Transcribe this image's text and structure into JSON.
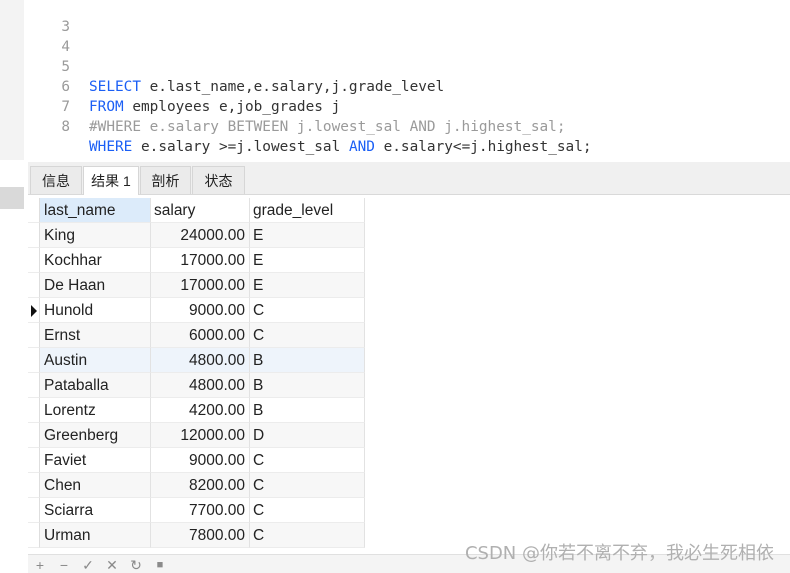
{
  "editor": {
    "lines": [
      {
        "num": "3"
      },
      {
        "num": "4"
      },
      {
        "num": "5",
        "kw1": "SELECT",
        "rest": " e.last_name,e.salary,j.grade_level"
      },
      {
        "num": "6",
        "kw1": "FROM",
        "rest": " employees e,job_grades j"
      },
      {
        "num": "7",
        "comment": "#WHERE e.salary BETWEEN j.lowest_sal AND j.highest_sal;"
      },
      {
        "num": "8",
        "kw1": "WHERE",
        "mid": " e.salary >=j.lowest_sal ",
        "kw2": "AND",
        "rest2": " e.salary<=j.highest_sal;"
      }
    ],
    "colors": {
      "keyword": "#1b5ff5",
      "comment": "#9a9a9a",
      "text": "#333333"
    }
  },
  "tabs": [
    {
      "label": "信息"
    },
    {
      "label": "结果 1",
      "active": true
    },
    {
      "label": "剖析"
    },
    {
      "label": "状态"
    }
  ],
  "grid": {
    "columns": [
      "last_name",
      "salary",
      "grade_level"
    ],
    "rows": [
      {
        "last_name": "King",
        "salary": "24000.00",
        "grade_level": "E"
      },
      {
        "last_name": "Kochhar",
        "salary": "17000.00",
        "grade_level": "E"
      },
      {
        "last_name": "De Haan",
        "salary": "17000.00",
        "grade_level": "E"
      },
      {
        "last_name": "Hunold",
        "salary": "9000.00",
        "grade_level": "C"
      },
      {
        "last_name": "Ernst",
        "salary": "6000.00",
        "grade_level": "C"
      },
      {
        "last_name": "Austin",
        "salary": "4800.00",
        "grade_level": "B"
      },
      {
        "last_name": "Pataballa",
        "salary": "4800.00",
        "grade_level": "B"
      },
      {
        "last_name": "Lorentz",
        "salary": "4200.00",
        "grade_level": "B"
      },
      {
        "last_name": "Greenberg",
        "salary": "12000.00",
        "grade_level": "D"
      },
      {
        "last_name": "Faviet",
        "salary": "9000.00",
        "grade_level": "C"
      },
      {
        "last_name": "Chen",
        "salary": "8200.00",
        "grade_level": "C"
      },
      {
        "last_name": "Sciarra",
        "salary": "7700.00",
        "grade_level": "C"
      },
      {
        "last_name": "Urman",
        "salary": "7800.00",
        "grade_level": "C"
      }
    ],
    "current_row_index": 3
  },
  "toolbar": {
    "icons": [
      "add-icon",
      "remove-icon",
      "check-icon",
      "cancel-icon",
      "refresh-icon",
      "stop-icon"
    ],
    "glyphs": [
      "+",
      "−",
      "✓",
      "✕",
      "↻",
      "■"
    ]
  },
  "watermark": "CSDN @你若不离不弃，我必生死相依"
}
